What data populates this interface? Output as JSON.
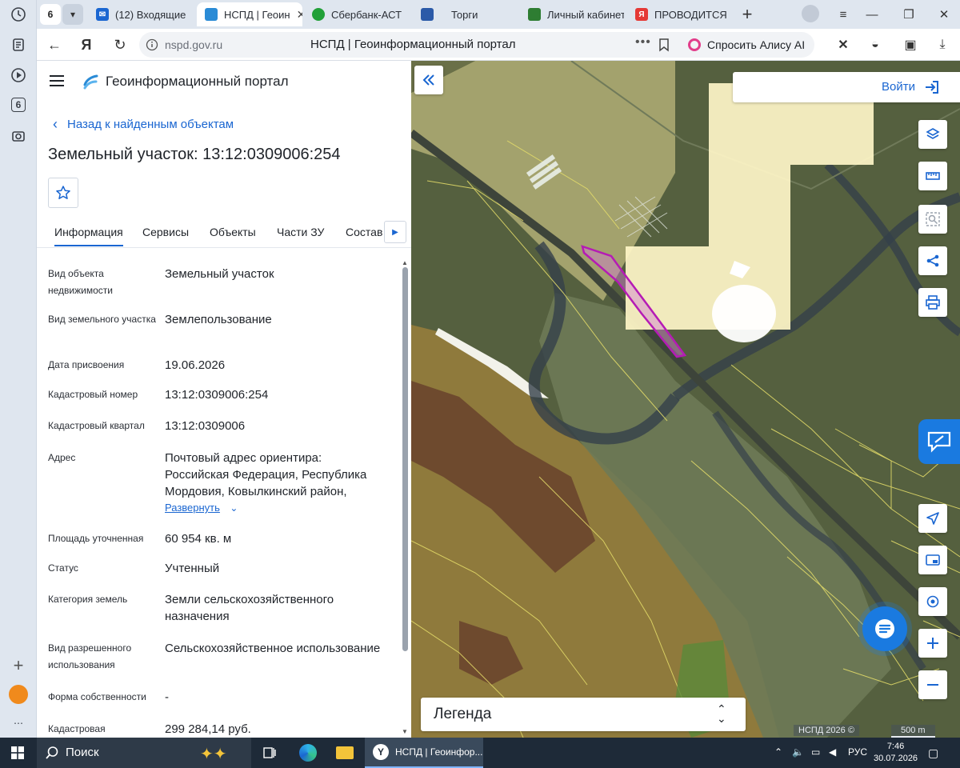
{
  "browser": {
    "tab_count": "6",
    "tabs": [
      {
        "label": "(12) Входящие -",
        "icon": "mail-icon",
        "color": "#1a66d1"
      },
      {
        "label": "НСПД | Геоин",
        "icon": "nspd-icon",
        "color": "#2a8bd6"
      },
      {
        "label": "Сбербанк-АСТ -",
        "icon": "sber-icon",
        "color": "#21a038"
      },
      {
        "label": "Торги",
        "icon": "emblem-icon",
        "color": "#2b5aa8"
      },
      {
        "label": "Личный кабинет",
        "icon": "gosuslugi-icon",
        "color": "#2e7d32"
      },
      {
        "label": "ПРОВОДИТСЯ /",
        "icon": "yandex-icon",
        "color": "#e53935"
      }
    ],
    "url_host": "nspd.gov.ru",
    "page_title": "НСПД | Геоинформационный портал",
    "alice_label": "Спросить Алису AI"
  },
  "rail": {
    "badge": "6"
  },
  "panel": {
    "portal_title": "Геоинформационный портал",
    "back_label": "Назад к найденным объектам",
    "title": "Земельный участок: 13:12:0309006:254",
    "tabs": [
      "Информация",
      "Сервисы",
      "Объекты",
      "Части ЗУ",
      "Состав"
    ],
    "rows": [
      {
        "k": "Вид объекта недвижимости",
        "v": "Земельный участок"
      },
      {
        "k": "Вид земельного участка",
        "v": "Землепользование"
      },
      {
        "k": "Дата присвоения",
        "v": "19.06.2026"
      },
      {
        "k": "Кадастровый номер",
        "v": "13:12:0309006:254"
      },
      {
        "k": "Кадастровый квартал",
        "v": "13:12:0309006"
      },
      {
        "k": "Адрес",
        "v": "Почтовый адрес ориентира: Российская Федерация, Республика Мордовия, Ковылкинский район,"
      },
      {
        "k": "Площадь уточненная",
        "v": "60 954 кв. м"
      },
      {
        "k": "Статус",
        "v": "Учтенный"
      },
      {
        "k": "Категория земель",
        "v": "Земли сельскохозяйственного назначения"
      },
      {
        "k": "Вид разрешенного использования",
        "v": "Сельскохозяйственное использование"
      },
      {
        "k": "Форма собственности",
        "v": "-"
      },
      {
        "k": "Кадастровая",
        "v": "299 284,14 руб."
      }
    ],
    "expand_label": "Развернуть"
  },
  "map": {
    "login_label": "Войти",
    "legend_label": "Легенда",
    "copyright": "НСПД 2026 ©",
    "scale_label": "500 m",
    "colors": {
      "accent": "#1a66d1",
      "parcel_highlight": "#b51bb5",
      "zone_yellow": "#fff6c8"
    }
  },
  "taskbar": {
    "search_label": "Поиск",
    "app_label": "НСПД | Геоинфор...",
    "lang": "РУС",
    "time": "7:46",
    "date": "30.07.2026"
  }
}
